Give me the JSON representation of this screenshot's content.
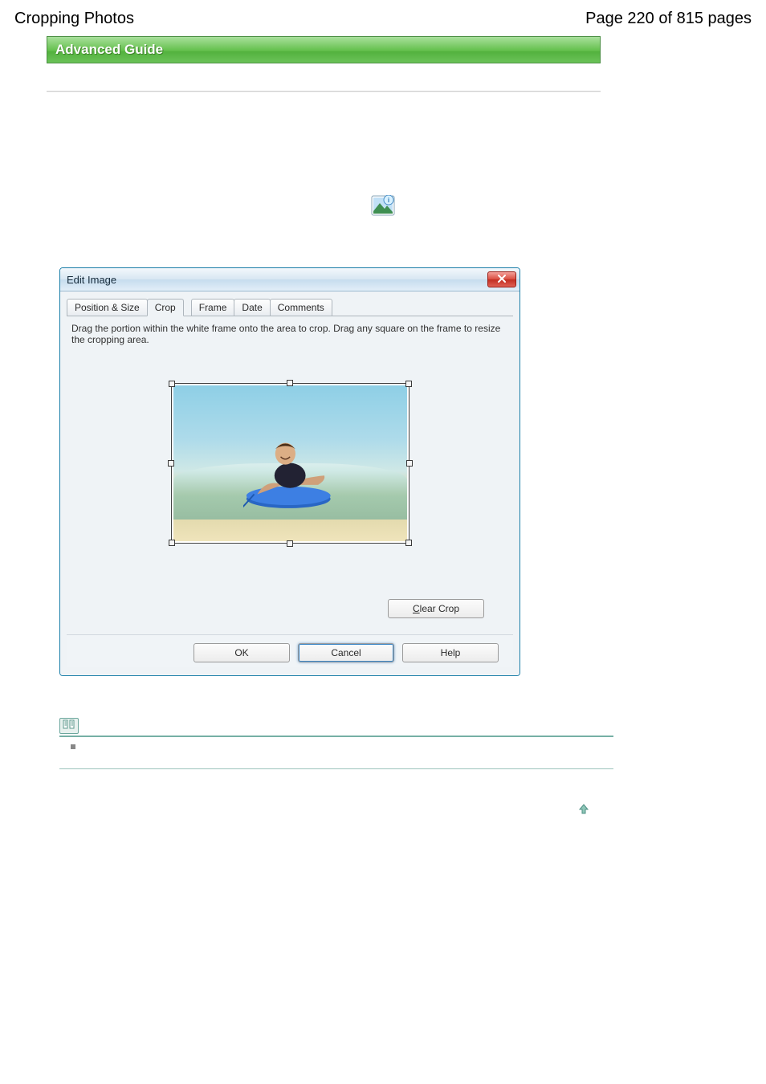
{
  "header": {
    "title_left": "Cropping Photos",
    "title_right": "Page 220 of 815 pages"
  },
  "banner": {
    "label": "Advanced Guide"
  },
  "dialog": {
    "title": "Edit Image",
    "tabs": {
      "position_size": "Position & Size",
      "crop": "Crop",
      "frame": "Frame",
      "date": "Date",
      "comments": "Comments"
    },
    "instruction": "Drag the portion within the white frame onto the area to crop. Drag any square on the frame to resize the cropping area.",
    "clear_crop": "Clear Crop",
    "ok": "OK",
    "cancel": "Cancel",
    "help": "Help"
  }
}
